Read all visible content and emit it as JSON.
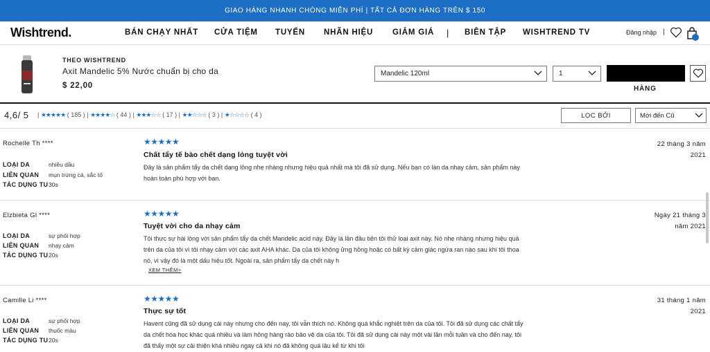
{
  "banner": {
    "text": "GIAO HÀNG NHANH CHÓNG MIỄN PHÍ | TẤT CẢ ĐƠN HÀNG TRÊN $ 150"
  },
  "header": {
    "logo": "Wishtrend.",
    "nav": [
      "BÁN CHẠY NHẤT",
      "CỬA TIỆM",
      "TUYỂN",
      "NHÃN HIỆU",
      "GIẢM GIÁ",
      "BIÊN TẬP",
      "WISHTREND TV"
    ],
    "separator": "|",
    "login": "Đăng nhập",
    "login_sep": "|",
    "icons": {
      "wishlist": "heart-icon",
      "cart": "shopping-bag-icon"
    },
    "accent": "#1d6fc6"
  },
  "product": {
    "brand": "THEO WISHTREND",
    "name": "Axit Mandelic 5% Nước chuẩn bị cho da",
    "price": "$ 22,00",
    "option_selected": "Mandelic 120ml",
    "quantity_selected": "1",
    "add_button_label": "",
    "add_button_sub": "HÀNG"
  },
  "summary": {
    "average": "4,6/ 5",
    "distribution": [
      {
        "stars": "★★★★★",
        "count": "185"
      },
      {
        "stars": "★★★★☆",
        "count": "44"
      },
      {
        "stars": "★★★☆☆",
        "count": "17"
      },
      {
        "stars": "★★☆☆☆",
        "count": "3"
      },
      {
        "stars": "★☆☆☆☆",
        "count": "4"
      }
    ],
    "filter_label": "LỌC BỞI",
    "sort_selected": "Mới đến Cũ"
  },
  "reviews": [
    {
      "name": "Rochelle Th ****",
      "attributes": [
        {
          "label": "LOẠI DA",
          "value": "nhiều dầu"
        },
        {
          "label": "LIÊN QUAN",
          "value": "mụn trứng cá, sắc tố"
        },
        {
          "label": "TÁC DỤNG TU",
          "value": "30s"
        }
      ],
      "stars": "★★★★★",
      "title": "Chất tẩy tế bào chết dạng lỏng tuyệt vời",
      "body": "Đây là sản phẩm tẩy da chết dạng lỏng nhẹ nhàng nhưng hiệu quả nhất mà tôi đã sử dụng. Nếu bạn có làn da nhạy cảm, sản phẩm này hoàn toàn phù hợp với bạn.",
      "date_line1": "22 tháng 3 năm",
      "date_line2": "2021",
      "more": ""
    },
    {
      "name": "Elzbieta Gl ****",
      "attributes": [
        {
          "label": "LOẠI DA",
          "value": "sự phối hợp"
        },
        {
          "label": "LIÊN QUAN",
          "value": "nhạy cảm"
        },
        {
          "label": "TÁC DỤNG TU",
          "value": "20s"
        }
      ],
      "stars": "★★★★★",
      "title": "Tuyệt vời cho da nhạy cảm",
      "body": "Tôi thực sự hài lòng với sản phẩm tẩy da chết Mandelic acid này. Đây là lần đầu tiên tôi thử loại axit này. Nó nhẹ nhàng nhưng hiệu quả trên da của tôi vì tôi nhạy cảm với các axit AHA khác. Da của tôi không ửng hồng hoặc có bất kỳ cảm giác ngứa ran nào sau khi tôi thoa nó, vì vậy đó là một dấu hiệu tốt. Ngoài ra, sản phẩm tẩy da chết này h",
      "date_line1": "Ngày 21 tháng 3",
      "date_line2": "năm 2021",
      "more": "XEM THÊM>"
    },
    {
      "name": "Camille Li ****",
      "attributes": [
        {
          "label": "LOẠI DA",
          "value": "sự phối hợp"
        },
        {
          "label": "LIÊN QUAN",
          "value": "thuốc màu"
        },
        {
          "label": "TÁC DỤNG TU",
          "value": "20s"
        }
      ],
      "stars": "★★★★★",
      "title": "Thực sự tốt",
      "body": "Havent cũng đã sử dụng cái này nhưng cho đến nay, tôi vẫn thích nó. Không quá khắc nghiệt trên da của tôi. Tôi đã sử dụng các chất tẩy da chết hóa học khác quá nhiều và làm hỏng hàng rào bảo vệ da của tôi. Tôi đã sử dụng cái này một vài lần mỗi tuần và cho đến nay, tôi đã thấy một sự cải thiện khá nhiều ngay cả khi nó đã không quá lâu kể từ khi tôi",
      "date_line1": "31 tháng 1 năm",
      "date_line2": "2021",
      "more": ""
    }
  ]
}
